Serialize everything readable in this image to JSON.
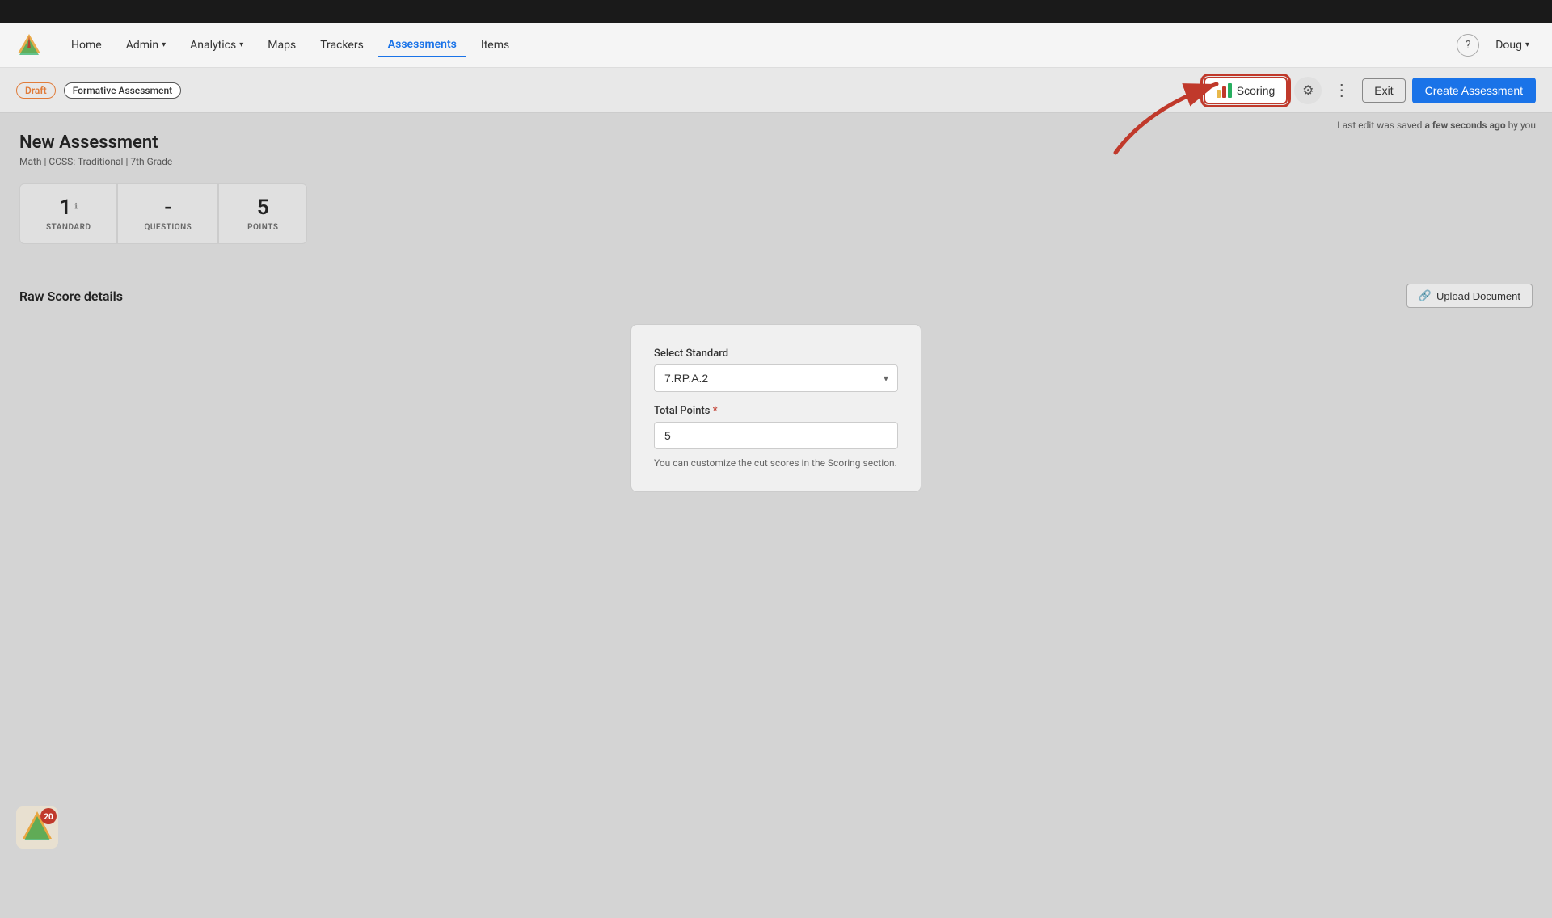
{
  "topBar": {
    "background": "#1a1a1a"
  },
  "navbar": {
    "logo": "app-logo",
    "links": [
      {
        "id": "home",
        "label": "Home",
        "active": false
      },
      {
        "id": "admin",
        "label": "Admin",
        "dropdown": true,
        "active": false
      },
      {
        "id": "analytics",
        "label": "Analytics",
        "dropdown": true,
        "active": false
      },
      {
        "id": "maps",
        "label": "Maps",
        "active": false
      },
      {
        "id": "trackers",
        "label": "Trackers",
        "active": false
      },
      {
        "id": "assessments",
        "label": "Assessments",
        "active": true
      },
      {
        "id": "items",
        "label": "Items",
        "active": false
      }
    ],
    "user": {
      "name": "Doug",
      "hasDropdown": true
    }
  },
  "toolbar": {
    "draft_label": "Draft",
    "formative_label": "Formative Assessment",
    "scoring_label": "Scoring",
    "exit_label": "Exit",
    "create_label": "Create Assessment",
    "last_saved": "Last edit was saved",
    "last_saved_emphasis": "a few seconds ago",
    "last_saved_suffix": "by you",
    "more_icon": "⋮"
  },
  "page": {
    "title": "New Assessment",
    "subtitle": "Math  |  CCSS: Traditional  |  7th Grade"
  },
  "stats": [
    {
      "id": "standard",
      "value": "1",
      "label": "STANDARD",
      "has_info": true
    },
    {
      "id": "questions",
      "value": "-",
      "label": "QUESTIONS"
    },
    {
      "id": "points",
      "value": "5",
      "label": "POINTS"
    }
  ],
  "rawScore": {
    "title": "Raw Score details",
    "upload_label": "Upload Document"
  },
  "form": {
    "select_label": "Select Standard",
    "select_value": "7.RP.A.2",
    "total_points_label": "Total Points",
    "total_points_required": true,
    "total_points_value": "5",
    "hint": "You can customize the cut scores in the Scoring section."
  }
}
